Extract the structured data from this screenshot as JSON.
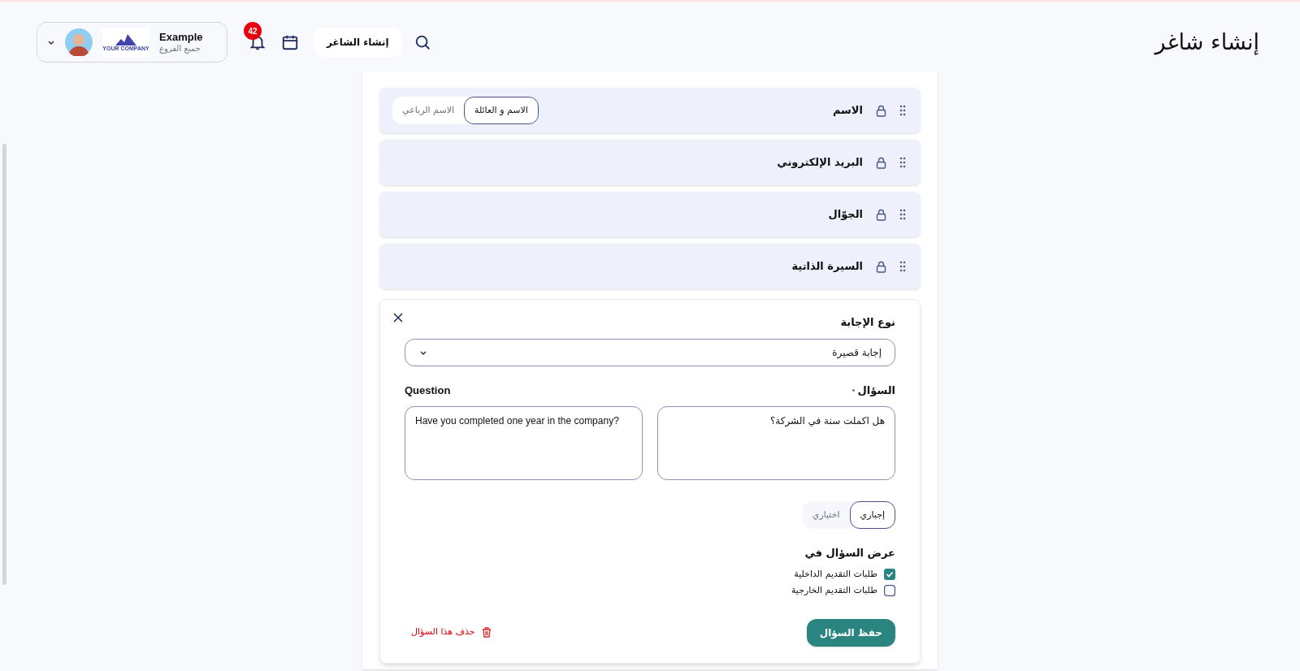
{
  "header": {
    "title": "إنشاء شاغر",
    "create_button": "إنشاء الشاغر",
    "notifications_count": "42",
    "account": {
      "name": "Example",
      "subtitle": "جميع الفروع",
      "logo_text": "YOUR COMPANY"
    }
  },
  "fields": [
    {
      "label": "الاسم",
      "locked": true,
      "options": [
        {
          "label": "الاسم و العائلة",
          "selected": true
        },
        {
          "label": "الاسم الرباعي",
          "selected": false
        }
      ]
    },
    {
      "label": "البريد الإلكتروني",
      "locked": true
    },
    {
      "label": "الجوّال",
      "locked": true
    },
    {
      "label": "السيرة الذاتية",
      "locked": true
    }
  ],
  "question_editor": {
    "answer_type_label": "نوع الإجابة",
    "answer_type_value": "إجابة قصيرة",
    "question_label_ar": "السؤال",
    "required": true,
    "question_label_en": "Question",
    "question_ar": "هل اكملت سنة في الشركة؟",
    "question_en": "Have you completed one year in the company?",
    "requirement_options": [
      {
        "label": "إجباري",
        "selected": true
      },
      {
        "label": "اختياري",
        "selected": false
      }
    ],
    "show_in_label": "عرض السؤال في",
    "show_in": [
      {
        "label": "طلبات التقديم الداخلية",
        "checked": true
      },
      {
        "label": "طلبات التقديم الخارجية",
        "checked": false
      }
    ],
    "save_button": "حفظ السؤال",
    "delete_link": "حذف هذا السؤال"
  }
}
